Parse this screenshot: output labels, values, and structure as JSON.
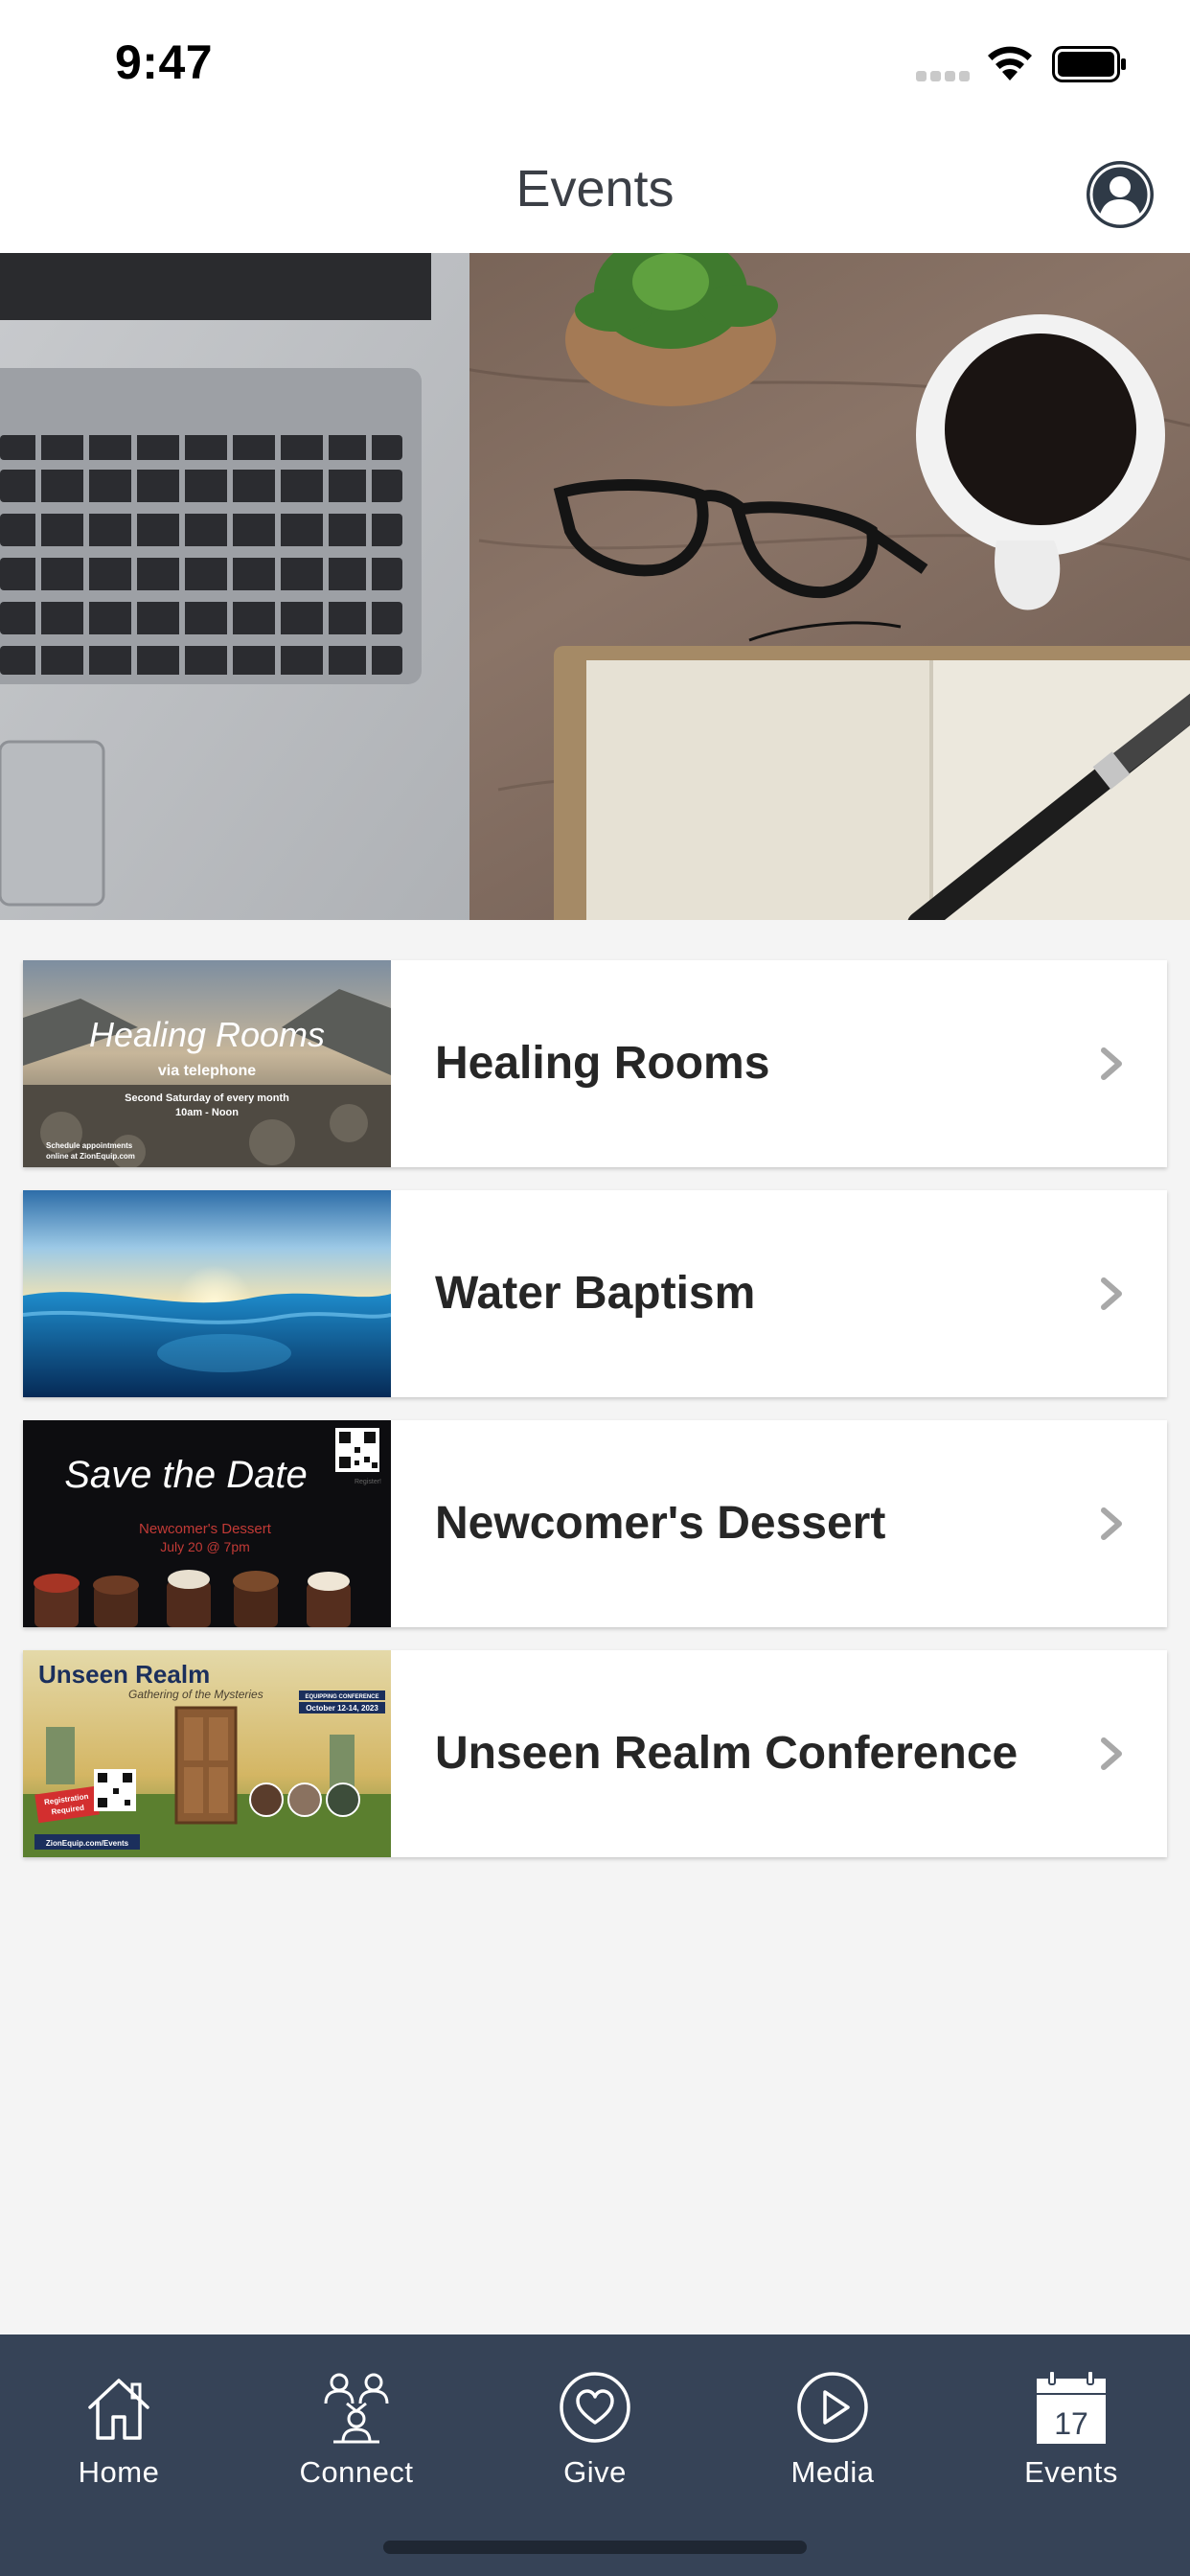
{
  "status_bar": {
    "time": "9:47"
  },
  "header": {
    "title": "Events",
    "profile_icon": "user-circle-icon"
  },
  "hero": {
    "image": "laptop-coffee-glasses-notebook-desk-photo"
  },
  "events": [
    {
      "title": "Healing Rooms",
      "thumb": {
        "script_title": "Healing Rooms",
        "subtitle": "via telephone",
        "line1": "Second Saturday of every month",
        "line2": "10am - Noon",
        "footer1": "Schedule appointments",
        "footer2": "online at ZionEquip.com"
      }
    },
    {
      "title": "Water Baptism",
      "thumb": {}
    },
    {
      "title": "Newcomer's Dessert",
      "thumb": {
        "script_title": "Save the Date",
        "line1": "Newcomer's Dessert",
        "line2": "July 20 @ 7pm",
        "qr_caption": "Register!"
      }
    },
    {
      "title": "Unseen Realm Conference",
      "thumb": {
        "title": "Unseen Realm",
        "script": "Gathering of the Mysteries",
        "tag": "EQUIPPING CONFERENCE",
        "dates": "October 12-14, 2023",
        "badge1": "Registration",
        "badge2": "Required",
        "url": "ZionEquip.com/Events"
      }
    }
  ],
  "tabs": [
    {
      "label": "Home",
      "icon": "home-icon"
    },
    {
      "label": "Connect",
      "icon": "people-icon"
    },
    {
      "label": "Give",
      "icon": "heart-circle-icon"
    },
    {
      "label": "Media",
      "icon": "play-circle-icon"
    },
    {
      "label": "Events",
      "icon": "calendar-icon",
      "calendar_day": "17",
      "active": true
    }
  ],
  "colors": {
    "tab_bar": "#364357",
    "header_bg": "#ffffff",
    "page_bg": "#f4f4f4",
    "title_text": "#262626",
    "chevron": "#a8a8a8"
  }
}
